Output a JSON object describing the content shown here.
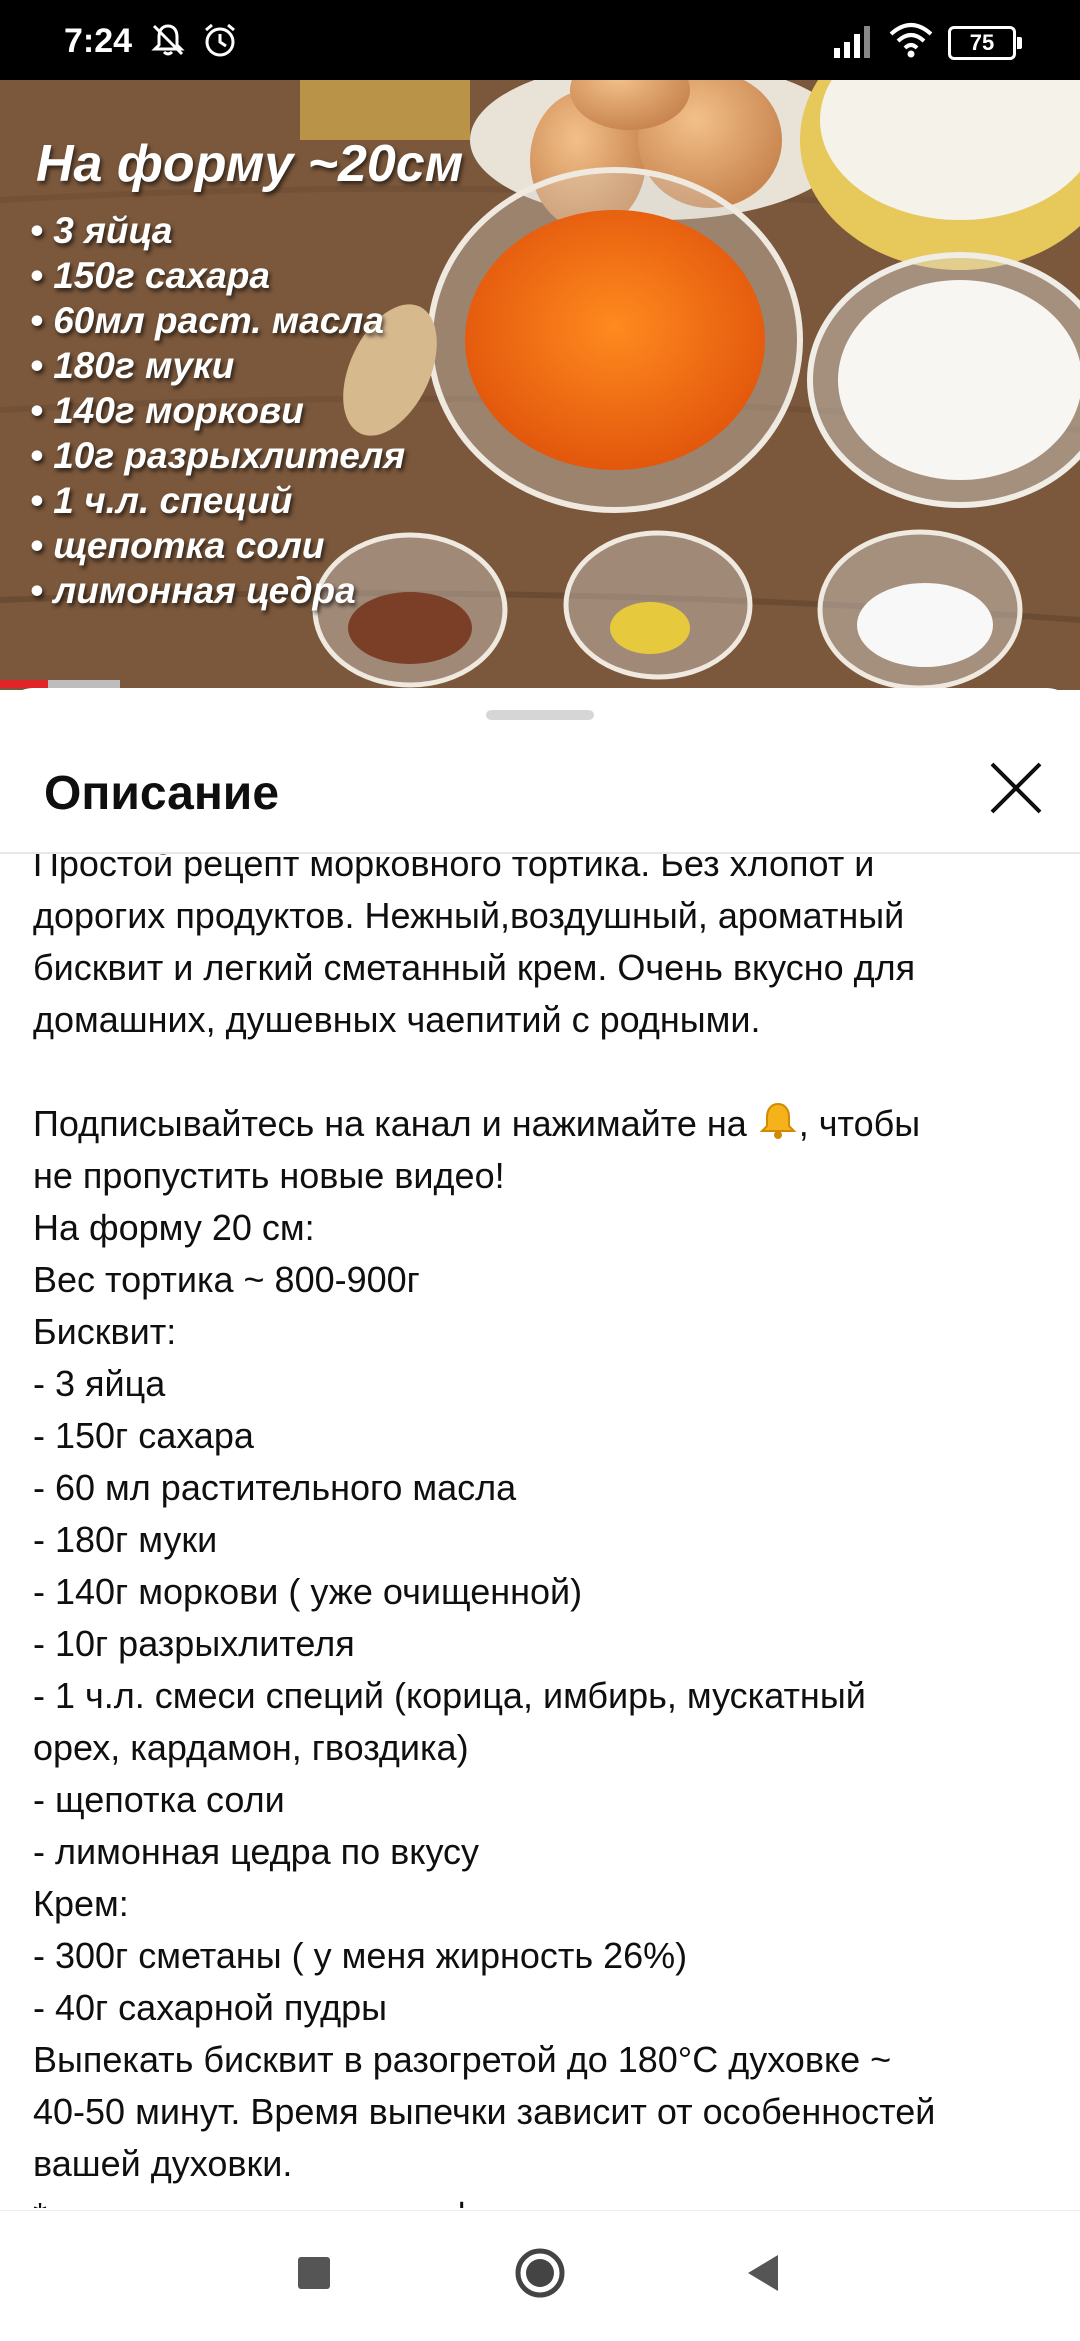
{
  "status_bar": {
    "time": "7:24",
    "battery": "75",
    "icons": [
      "mute-icon",
      "alarm-icon",
      "signal-icon",
      "wifi-icon",
      "battery-icon"
    ]
  },
  "video": {
    "overlay_title": "На форму ~20см",
    "overlay_ingredients": [
      "3 яйца",
      "150г сахара",
      "60мл раст. масла",
      "180г муки",
      "140г моркови",
      "10г разрыхлителя",
      "1 ч.л. специй",
      "щепотка соли",
      "лимонная цедра"
    ],
    "progress_fraction": 0.4
  },
  "sheet": {
    "title": "Описание",
    "close_icon": "close-icon",
    "description_intro": "Простой рецепт морковного тортика. Без хлопот и\nдорогих продуктов. Нежный,воздушный, ароматный\nбисквит и легкий сметанный крем. Очень вкусно для\nдомашних, душевных чаепитий с родными.\n\nПодписывайтесь на канал и нажимайте на ",
    "description_main": ", чтобы\nне пропустить новые видео!\nНа форму 20 см:\nВес тортика ~ 800-900г\nБисквит:\n- 3 яйца\n- 150г сахара\n- 60 мл растительного масла\n- 180г муки\n- 140г моркови ( уже очищенной)\n- 10г разрыхлителя\n- 1 ч.л. смеси специй (корица, имбирь, мускатный\nорех, кардамон, гвоздика)\n- щепотка соли\n- лимонная цедра по вкусу\nКрем:\n- 300г сметаны ( у меня жирность 26%)\n- 40г сахарной пудры\nВыпекать бисквит в разогретой до 180°С духовке ~\n40-50 минут. Время выпечки зависит от особенностей\nвашей духовки.\n* для украшения курага, фисташки",
    "bell_emoji": "🔔"
  },
  "navbar": {
    "buttons": [
      "recents-button",
      "home-button",
      "back-button"
    ]
  },
  "colors": {
    "progress": "#e0242a",
    "status_bar": "#000000",
    "sheet_bg": "#ffffff"
  }
}
